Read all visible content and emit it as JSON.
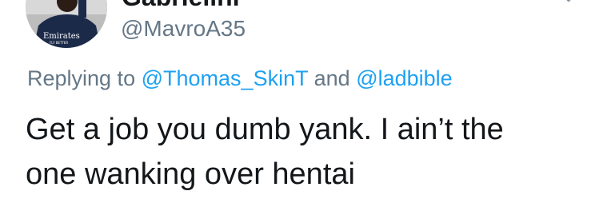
{
  "author": {
    "display_name": "Gabrielini",
    "handle": "@MavroA35",
    "avatar_sponsor": "Emirates",
    "avatar_sponsor_tagline": "FLY BETTER"
  },
  "reply": {
    "prefix": "Replying to",
    "mention_1": "@Thomas_SkinT",
    "conjunction": "and",
    "mention_2": "@ladbible"
  },
  "tweet": {
    "line_1": "Get a job you dumb yank. I ain’t the",
    "line_2": "one wanking over hentai"
  },
  "colors": {
    "text": "#14171a",
    "secondary": "#657786",
    "link": "#1da1f2"
  },
  "icons": {
    "menu": "chevron-down-icon"
  }
}
